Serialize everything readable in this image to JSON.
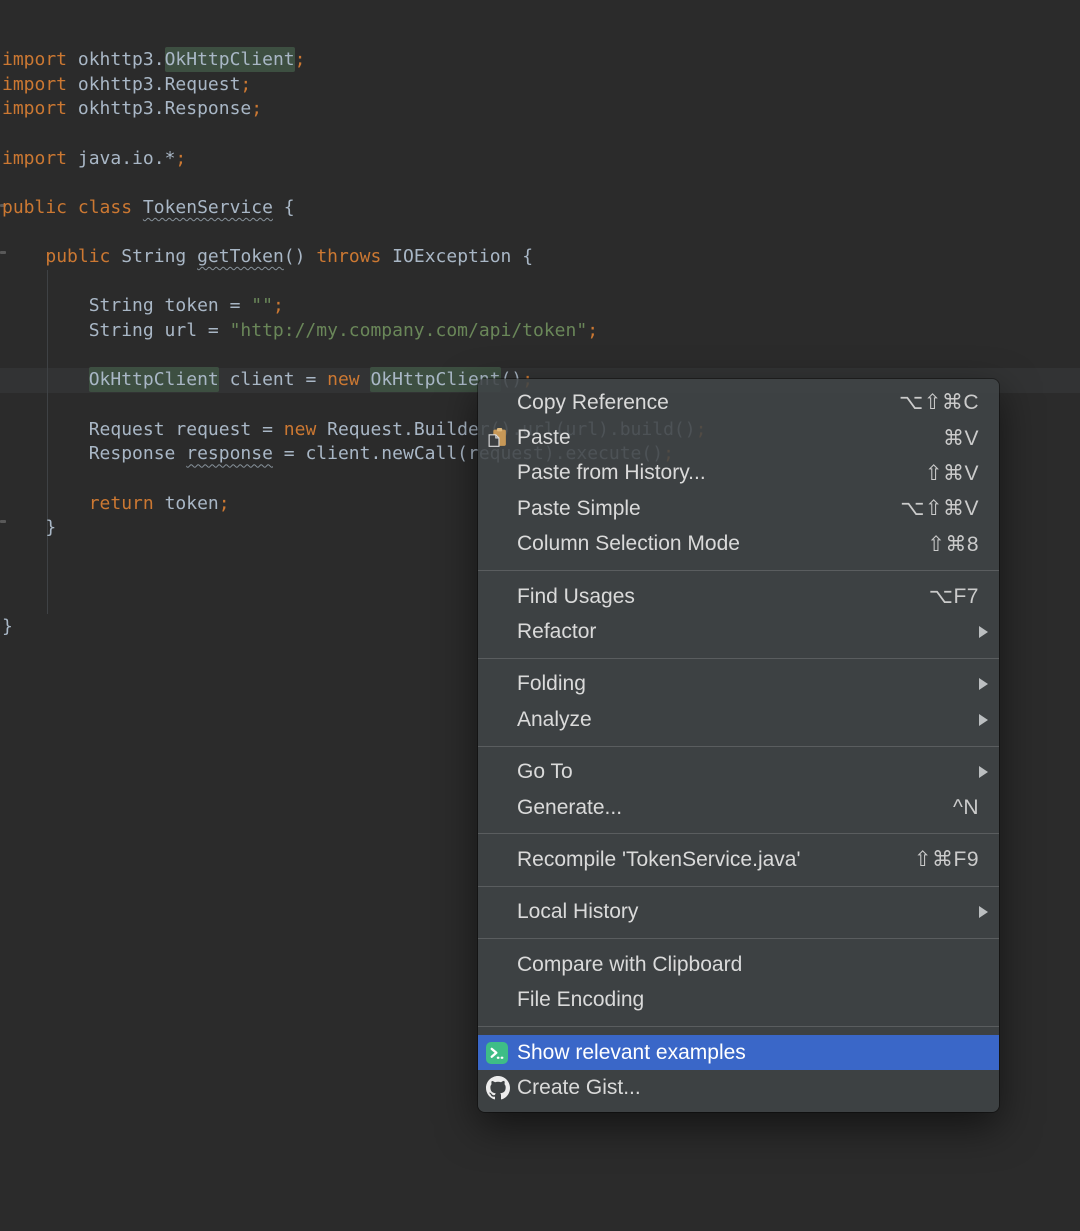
{
  "editor": {
    "background": "#2b2b2b",
    "current_line_background": "#323334",
    "usage_highlight_background": "#3d4f41",
    "token_colors": {
      "keyword": "#cc7832",
      "string": "#6a8759",
      "plain": "#a9b7c6"
    },
    "lines": [
      [
        [
          "kw",
          "import"
        ],
        [
          "id",
          " okhttp3."
        ],
        [
          "hl",
          "OkHttpClient"
        ],
        [
          "kw",
          ";"
        ]
      ],
      [
        [
          "kw",
          "import"
        ],
        [
          "id",
          " okhttp3.Request"
        ],
        [
          "kw",
          ";"
        ]
      ],
      [
        [
          "kw",
          "import"
        ],
        [
          "id",
          " okhttp3.Response"
        ],
        [
          "kw",
          ";"
        ]
      ],
      [],
      [
        [
          "kw",
          "import"
        ],
        [
          "id",
          " java.io.*"
        ],
        [
          "kw",
          ";"
        ]
      ],
      [],
      [
        [
          "kw",
          "public class"
        ],
        [
          "id",
          " "
        ],
        [
          "ul",
          "TokenService"
        ],
        [
          "id",
          " {"
        ]
      ],
      [],
      [
        [
          "id",
          "    "
        ],
        [
          "kw",
          "public"
        ],
        [
          "id",
          " String "
        ],
        [
          "ul",
          "getToken"
        ],
        [
          "id",
          "() "
        ],
        [
          "kw",
          "throws"
        ],
        [
          "id",
          " IOException {"
        ]
      ],
      [],
      [
        [
          "id",
          "        String token = "
        ],
        [
          "str",
          "\"\""
        ],
        [
          "kw",
          ";"
        ]
      ],
      [
        [
          "id",
          "        String url = "
        ],
        [
          "str",
          "\"http://my.company.com/api/token\""
        ],
        [
          "kw",
          ";"
        ]
      ],
      [],
      [
        [
          "id",
          "        "
        ],
        [
          "hl",
          "OkHttpClient"
        ],
        [
          "id",
          " client = "
        ],
        [
          "kw",
          "new"
        ],
        [
          "id",
          " "
        ],
        [
          "hl",
          "OkHttpClient"
        ],
        [
          "id",
          "()"
        ],
        [
          "kw",
          ";"
        ]
      ],
      [],
      [
        [
          "id",
          "        Request request = "
        ],
        [
          "kw",
          "new"
        ],
        [
          "id",
          " Request.Builder().url(url).build()"
        ],
        [
          "kw",
          ";"
        ]
      ],
      [
        [
          "id",
          "        Response "
        ],
        [
          "ul",
          "response"
        ],
        [
          "id",
          " = client.newCall(request).execute()"
        ],
        [
          "kw",
          ";"
        ]
      ],
      [],
      [
        [
          "id",
          "        "
        ],
        [
          "kw",
          "return"
        ],
        [
          "id",
          " token"
        ],
        [
          "kw",
          ";"
        ]
      ],
      [
        [
          "id",
          "    }"
        ]
      ],
      [],
      [],
      [],
      [
        [
          "id",
          "}"
        ]
      ]
    ]
  },
  "context_menu": {
    "selection_background": "#3a67c8",
    "terminal_icon_color": "#3ebd87",
    "sections": [
      {
        "items": [
          {
            "label": "Copy Reference",
            "shortcut": "⌥⇧⌘C"
          },
          {
            "label": "Paste",
            "shortcut": "⌘V",
            "icon": "paste"
          },
          {
            "label": "Paste from History...",
            "shortcut": "⇧⌘V"
          },
          {
            "label": "Paste Simple",
            "shortcut": "⌥⇧⌘V"
          },
          {
            "label": "Column Selection Mode",
            "shortcut": "⇧⌘8"
          }
        ]
      },
      {
        "items": [
          {
            "label": "Find Usages",
            "shortcut": "⌥F7"
          },
          {
            "label": "Refactor",
            "submenu": true
          }
        ]
      },
      {
        "items": [
          {
            "label": "Folding",
            "submenu": true
          },
          {
            "label": "Analyze",
            "submenu": true
          }
        ]
      },
      {
        "items": [
          {
            "label": "Go To",
            "submenu": true
          },
          {
            "label": "Generate...",
            "shortcut": "^N"
          }
        ]
      },
      {
        "items": [
          {
            "label": "Recompile 'TokenService.java'",
            "shortcut": "⇧⌘F9"
          }
        ]
      },
      {
        "items": [
          {
            "label": "Local History",
            "submenu": true
          }
        ]
      },
      {
        "items": [
          {
            "label": "Compare with Clipboard"
          },
          {
            "label": "File Encoding"
          }
        ]
      },
      {
        "items": [
          {
            "label": "Show relevant examples",
            "icon": "terminal",
            "selected": true
          },
          {
            "label": "Create Gist...",
            "icon": "github"
          }
        ]
      }
    ]
  }
}
